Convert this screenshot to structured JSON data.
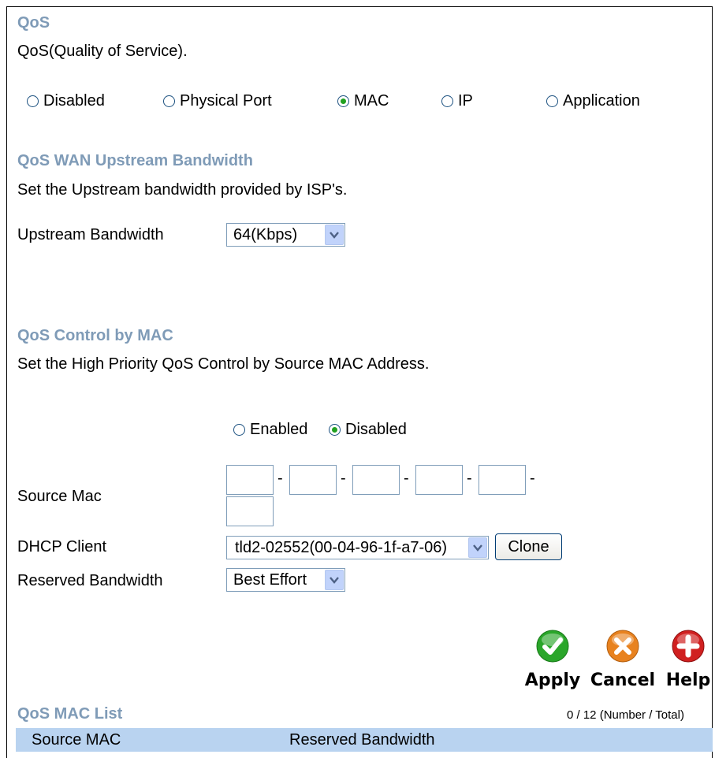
{
  "qos": {
    "title": "QoS",
    "desc": "QoS(Quality of Service).",
    "modes": [
      "Disabled",
      "Physical Port",
      "MAC",
      "IP",
      "Application"
    ],
    "selected_mode": "MAC"
  },
  "wan": {
    "title": "QoS WAN Upstream Bandwidth",
    "desc": "Set the Upstream bandwidth provided by ISP's.",
    "label": "Upstream Bandwidth",
    "value": "64(Kbps)"
  },
  "mac_control": {
    "title": "QoS Control by MAC",
    "desc": "Set the High Priority QoS Control by Source MAC Address.",
    "enabled_label": "Enabled",
    "disabled_label": "Disabled",
    "selected": "Disabled",
    "source_mac_label": "Source Mac",
    "dhcp_label": "DHCP Client",
    "dhcp_value": "tld2-02552(00-04-96-1f-a7-06)",
    "clone_label": "Clone",
    "reserved_label": "Reserved Bandwidth",
    "reserved_value": "Best Effort"
  },
  "actions": {
    "apply": "Apply",
    "cancel": "Cancel",
    "help": "Help"
  },
  "list": {
    "title": "QoS MAC List",
    "count": "0 / 12 (Number / Total)",
    "columns": [
      "Source MAC",
      "Reserved Bandwidth"
    ]
  },
  "colors": {
    "heading": "#7f9bb7",
    "apply": "#2aa62a",
    "cancel": "#e8821f",
    "help": "#d02020",
    "list_header": "#b9d3f0"
  }
}
